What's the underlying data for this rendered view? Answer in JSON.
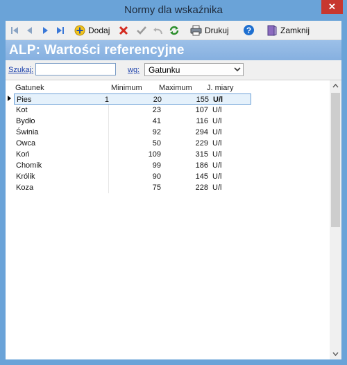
{
  "window": {
    "title": "Normy dla wskaźnika",
    "close_label": "✕"
  },
  "toolbar": {
    "add_label": "Dodaj",
    "print_label": "Drukuj",
    "close_label": "Zamknij"
  },
  "header": {
    "title": "ALP: Wartości referencyjne"
  },
  "search": {
    "label": "Szukaj:",
    "value": "",
    "by_label": "wg:",
    "by_value": "Gatunku"
  },
  "table": {
    "columns": [
      "Gatunek",
      "Minimum",
      "Maximum",
      "J. miary"
    ],
    "rows": [
      {
        "name": "Pies",
        "index": "1",
        "min": "20",
        "max": "155",
        "unit": "U/l"
      },
      {
        "name": "Kot",
        "index": "",
        "min": "23",
        "max": "107",
        "unit": "U/l"
      },
      {
        "name": "Bydło",
        "index": "",
        "min": "41",
        "max": "116",
        "unit": "U/l"
      },
      {
        "name": "Świnia",
        "index": "",
        "min": "92",
        "max": "294",
        "unit": "U/l"
      },
      {
        "name": "Owca",
        "index": "",
        "min": "50",
        "max": "229",
        "unit": "U/l"
      },
      {
        "name": "Koń",
        "index": "",
        "min": "109",
        "max": "315",
        "unit": "U/l"
      },
      {
        "name": "Chomik",
        "index": "",
        "min": "99",
        "max": "186",
        "unit": "U/l"
      },
      {
        "name": "Królik",
        "index": "",
        "min": "90",
        "max": "145",
        "unit": "U/l"
      },
      {
        "name": "Koza",
        "index": "",
        "min": "75",
        "max": "228",
        "unit": "U/l"
      }
    ]
  },
  "colors": {
    "window_border": "#6aa3d8",
    "header_bg": "#8fb7e4",
    "close_button": "#c7372f",
    "link": "#1a3faa"
  }
}
